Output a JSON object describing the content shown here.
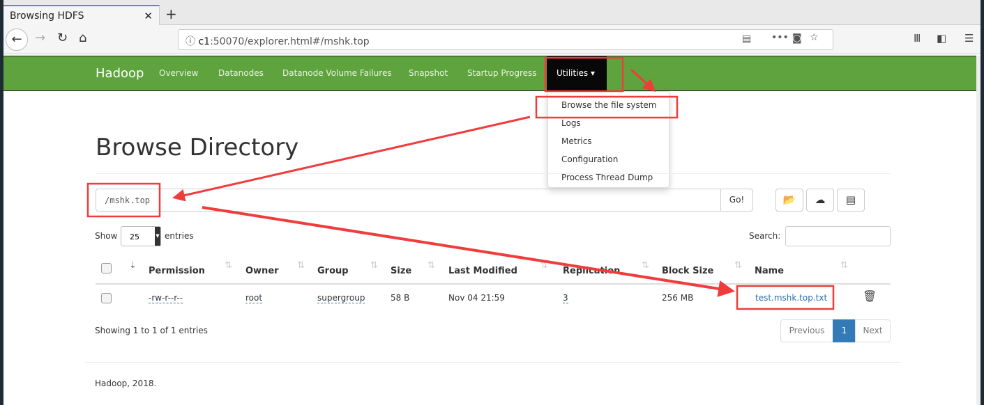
{
  "browser": {
    "tab_title": "Browsing HDFS",
    "url_host": "c1",
    "url_rest": ":50070/explorer.html#/mshk.top"
  },
  "navbar": {
    "brand": "Hadoop",
    "items": [
      "Overview",
      "Datanodes",
      "Datanode Volume Failures",
      "Snapshot",
      "Startup Progress"
    ],
    "utilities": "Utilities"
  },
  "dropdown": [
    "Browse the file system",
    "Logs",
    "Metrics",
    "Configuration",
    "Process Thread Dump"
  ],
  "page": {
    "title": "Browse Directory",
    "path": "/mshk.top",
    "go": "Go!"
  },
  "table_controls": {
    "show": "Show",
    "entries_value": "25",
    "entries": "entries",
    "search_label": "Search:"
  },
  "table": {
    "columns": [
      "Permission",
      "Owner",
      "Group",
      "Size",
      "Last Modified",
      "Replication",
      "Block Size",
      "Name"
    ],
    "rows": [
      {
        "permission": "-rw-r--r--",
        "owner": "root",
        "group": "supergroup",
        "size": "58 B",
        "modified": "Nov 04 21:59",
        "replication": "3",
        "block_size": "256 MB",
        "name": "test.mshk.top.txt"
      }
    ]
  },
  "info": "Showing 1 to 1 of 1 entries",
  "pagination": {
    "previous": "Previous",
    "page": "1",
    "next": "Next"
  },
  "footer": "Hadoop, 2018.",
  "colors": {
    "navbar": "#5fa33e",
    "annotation": "#f03c3c",
    "link": "#2a6fb0",
    "active_page": "#337ab7"
  }
}
